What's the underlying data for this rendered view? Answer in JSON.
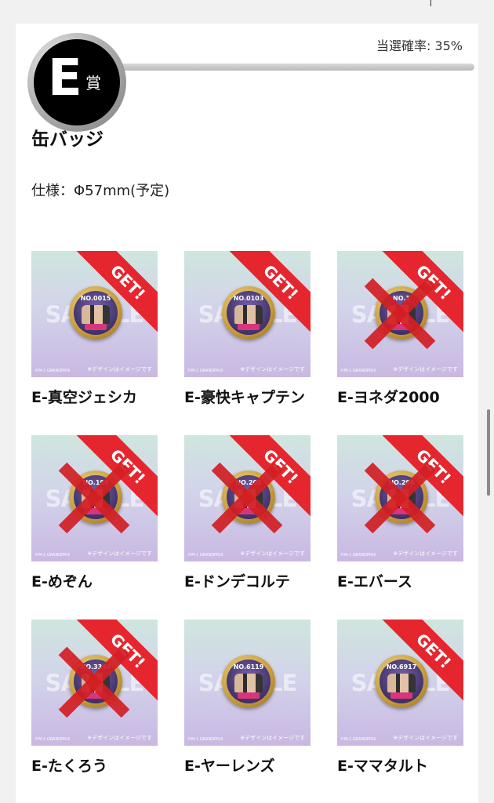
{
  "prize": {
    "letter": "E",
    "kanji": "賞",
    "win_rate": "当選確率: 35%",
    "title": "缶バッジ",
    "spec": "仕様：Φ57mm(予定)"
  },
  "common": {
    "sample_text": "SAMPLE",
    "note_text": "※デザインはイメージです",
    "copy_text": "©M-1 GRANDPRIX",
    "get_text": "GET!"
  },
  "items": [
    {
      "label": "E-真空ジェシカ",
      "pin_no": "NO.0015",
      "get": true,
      "crossed": false
    },
    {
      "label": "E-豪快キャプテン",
      "pin_no": "NO.0103",
      "get": true,
      "crossed": false
    },
    {
      "label": "E-ヨネダ2000",
      "pin_no": "NO.1",
      "get": true,
      "crossed": true
    },
    {
      "label": "E-めぞん",
      "pin_no": "NO.199",
      "get": true,
      "crossed": true
    },
    {
      "label": "E-ドンデコルテ",
      "pin_no": "NO.200",
      "get": true,
      "crossed": true
    },
    {
      "label": "E-エバース",
      "pin_no": "NO.296",
      "get": true,
      "crossed": true
    },
    {
      "label": "E-たくろう",
      "pin_no": "NO.3344",
      "get": true,
      "crossed": true
    },
    {
      "label": "E-ヤーレンズ",
      "pin_no": "NO.6119",
      "get": false,
      "crossed": false
    },
    {
      "label": "E-ママタルト",
      "pin_no": "NO.6917",
      "get": true,
      "crossed": false
    }
  ],
  "colors": {
    "ribbon": "#e6262e",
    "cross": "#d31f24",
    "badge_bg": "#000000"
  }
}
